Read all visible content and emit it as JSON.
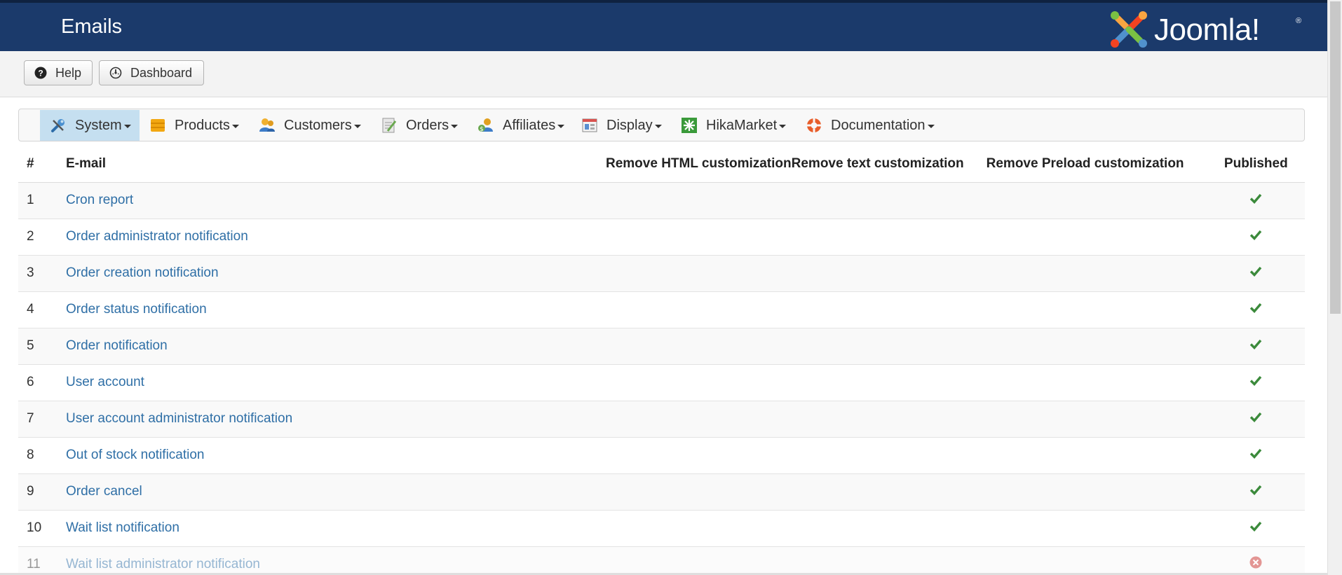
{
  "header": {
    "title": "Emails",
    "logo_text": "Joomla!",
    "logo_mark": "®"
  },
  "toolbar": {
    "help_label": "Help",
    "dashboard_label": "Dashboard"
  },
  "menu": [
    {
      "label": "System",
      "icon": "wrench-icon",
      "active": true
    },
    {
      "label": "Products",
      "icon": "box-icon"
    },
    {
      "label": "Customers",
      "icon": "users-icon"
    },
    {
      "label": "Orders",
      "icon": "orders-icon"
    },
    {
      "label": "Affiliates",
      "icon": "affiliates-icon"
    },
    {
      "label": "Display",
      "icon": "display-icon"
    },
    {
      "label": "HikaMarket",
      "icon": "hikamarket-icon"
    },
    {
      "label": "Documentation",
      "icon": "lifebuoy-icon"
    }
  ],
  "table": {
    "headers": {
      "num": "#",
      "email": "E-mail",
      "remove_html": "Remove HTML customization",
      "remove_text": "Remove text customization",
      "remove_preload": "Remove Preload customization",
      "published": "Published"
    },
    "rows": [
      {
        "num": "1",
        "email": "Cron report",
        "published": true
      },
      {
        "num": "2",
        "email": "Order administrator notification",
        "published": true
      },
      {
        "num": "3",
        "email": "Order creation notification",
        "published": true
      },
      {
        "num": "4",
        "email": "Order status notification",
        "published": true
      },
      {
        "num": "5",
        "email": "Order notification",
        "published": true
      },
      {
        "num": "6",
        "email": "User account",
        "published": true
      },
      {
        "num": "7",
        "email": "User account administrator notification",
        "published": true
      },
      {
        "num": "8",
        "email": "Out of stock notification",
        "published": true
      },
      {
        "num": "9",
        "email": "Order cancel",
        "published": true
      },
      {
        "num": "10",
        "email": "Wait list notification",
        "published": true
      },
      {
        "num": "11",
        "email": "Wait list administrator notification",
        "published": false
      }
    ]
  },
  "colors": {
    "header_bg": "#1b3a6b",
    "link": "#2f6fa6",
    "published": "#3b8a3b",
    "unpublished": "#c9302c",
    "menu_active": "#c5dff0"
  }
}
